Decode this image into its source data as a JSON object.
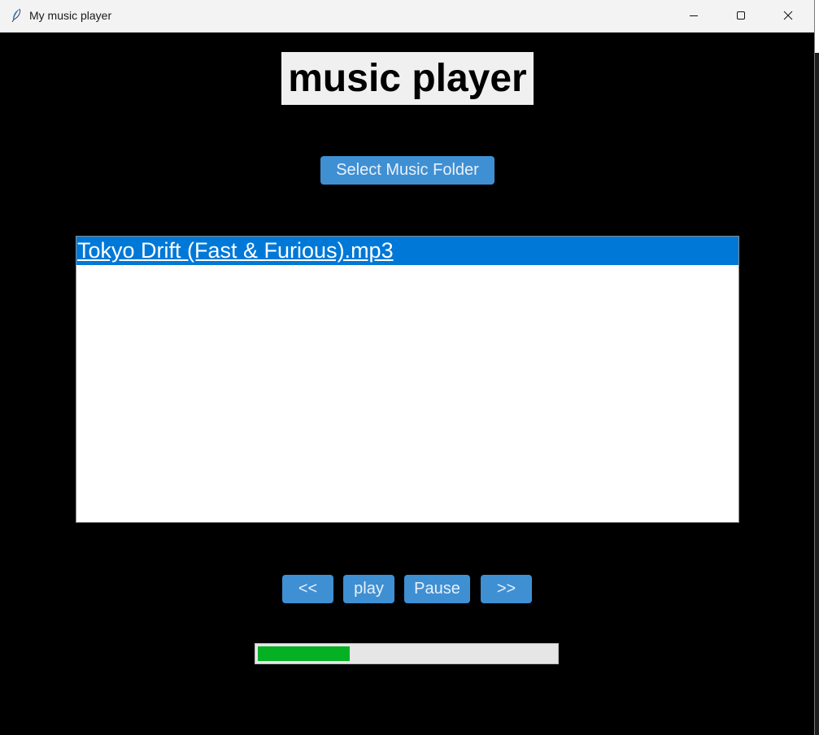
{
  "window": {
    "title": "My music player",
    "icon": "feather-icon",
    "controls": [
      "minimize-icon",
      "maximize-icon",
      "close-icon"
    ]
  },
  "header": {
    "title": "music player"
  },
  "toolbar": {
    "select_folder_label": "Select Music Folder"
  },
  "playlist": {
    "items": [
      {
        "label": "Tokyo Drift (Fast & Furious).mp3",
        "selected": true
      }
    ]
  },
  "controls": {
    "prev_label": "<<",
    "play_label": "play",
    "pause_label": "Pause",
    "next_label": ">>"
  },
  "progress": {
    "value": 0.31
  },
  "colors": {
    "background": "#000000",
    "button": "#3f8fd3",
    "selection": "#0078d7",
    "progress_fill": "#06b025"
  }
}
